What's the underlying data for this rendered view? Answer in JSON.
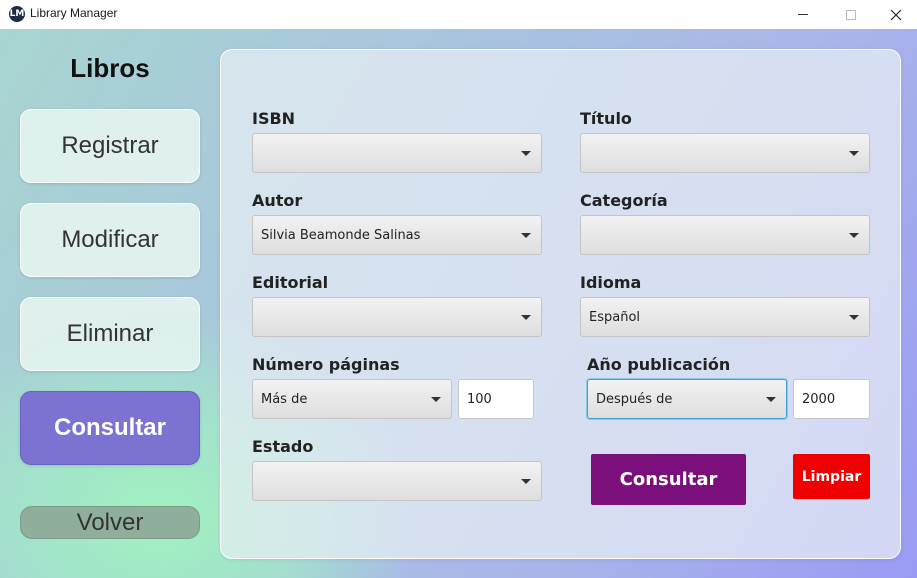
{
  "window": {
    "title": "Library Manager",
    "icon_text": "LM"
  },
  "sidebar": {
    "title": "Libros",
    "items": [
      {
        "label": "Registrar",
        "active": false
      },
      {
        "label": "Modificar",
        "active": false
      },
      {
        "label": "Eliminar",
        "active": false
      },
      {
        "label": "Consultar",
        "active": true
      }
    ],
    "back_label": "Volver"
  },
  "form": {
    "isbn": {
      "label": "ISBN",
      "value": ""
    },
    "titulo": {
      "label": "Título",
      "value": ""
    },
    "autor": {
      "label": "Autor",
      "value": "Silvia Beamonde Salinas"
    },
    "categoria": {
      "label": "Categoría",
      "value": ""
    },
    "editorial": {
      "label": "Editorial",
      "value": ""
    },
    "idioma": {
      "label": "Idioma",
      "value": "Español"
    },
    "paginas": {
      "label": "Número páginas",
      "operator": "Más de",
      "value": "100"
    },
    "anio": {
      "label": "Año publicación",
      "operator": "Después de",
      "value": "2000"
    },
    "estado": {
      "label": "Estado",
      "value": ""
    },
    "submit_label": "Consultar",
    "clear_label": "Limpiar"
  },
  "colors": {
    "active_nav": "#7b72d2",
    "submit_button": "#7b0f7b",
    "clear_button": "#f00000",
    "focus_border": "#3ba0d6"
  }
}
